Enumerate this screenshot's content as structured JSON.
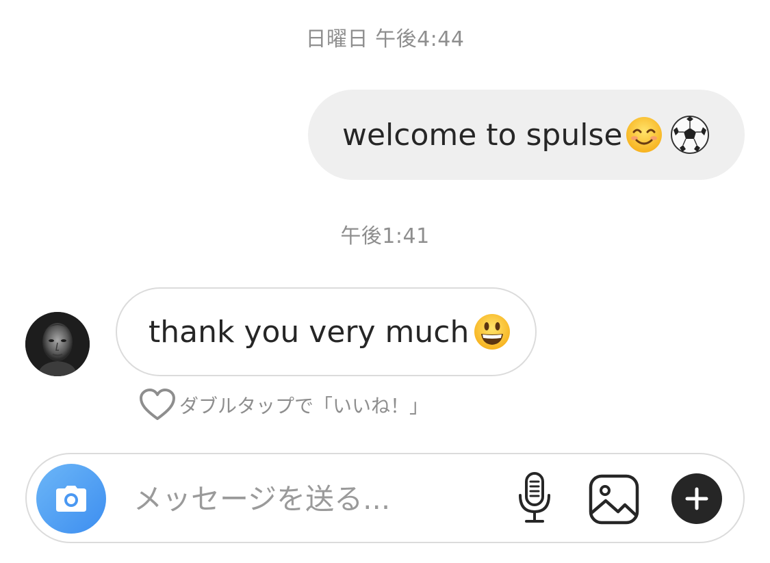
{
  "thread": {
    "timestamp_1": "日曜日 午後4:44",
    "timestamp_2": "午後1:41"
  },
  "messages": [
    {
      "direction": "outgoing",
      "text": "welcome to spulse",
      "emojis": [
        "smiling-face-emoji",
        "soccer-ball-emoji"
      ]
    },
    {
      "direction": "incoming",
      "text": "thank you very much",
      "emojis": [
        "grinning-face-emoji"
      ],
      "like_hint": "ダブルタップで「いいね！」"
    }
  ],
  "composer": {
    "placeholder": "メッセージを送る...",
    "icons": [
      "camera-icon",
      "microphone-icon",
      "gallery-icon",
      "plus-icon"
    ]
  },
  "colors": {
    "outgoing_bubble": "#efefef",
    "border": "#dbdbdb",
    "muted_text": "#8e8e8e",
    "camera_gradient_start": "#6cb6f7",
    "camera_gradient_end": "#3d8ef0",
    "plus_button": "#262626"
  }
}
